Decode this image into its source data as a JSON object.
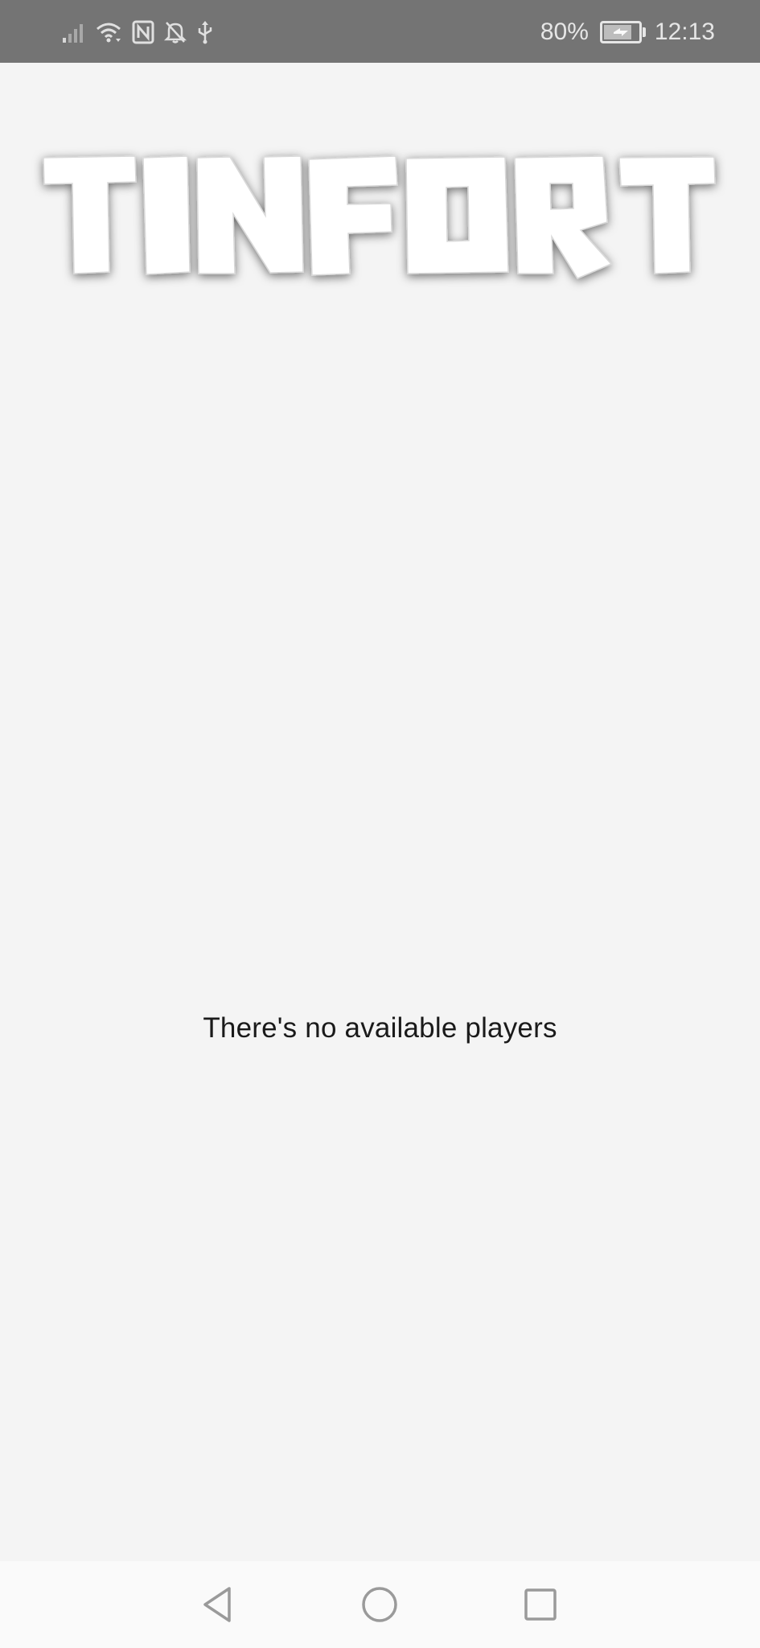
{
  "status_bar": {
    "battery_percent": "80%",
    "battery_level": 0.8,
    "time": "12:13",
    "icons": [
      "signal-icon",
      "wifi-icon",
      "nfc-icon",
      "notifications-off-icon",
      "usb-icon",
      "battery-charging-icon"
    ]
  },
  "app": {
    "logo_text": "TINFORT"
  },
  "main": {
    "empty_message": "There's no available players"
  },
  "nav_bar": {
    "icons": [
      "back-icon",
      "home-icon",
      "recent-apps-icon"
    ]
  }
}
